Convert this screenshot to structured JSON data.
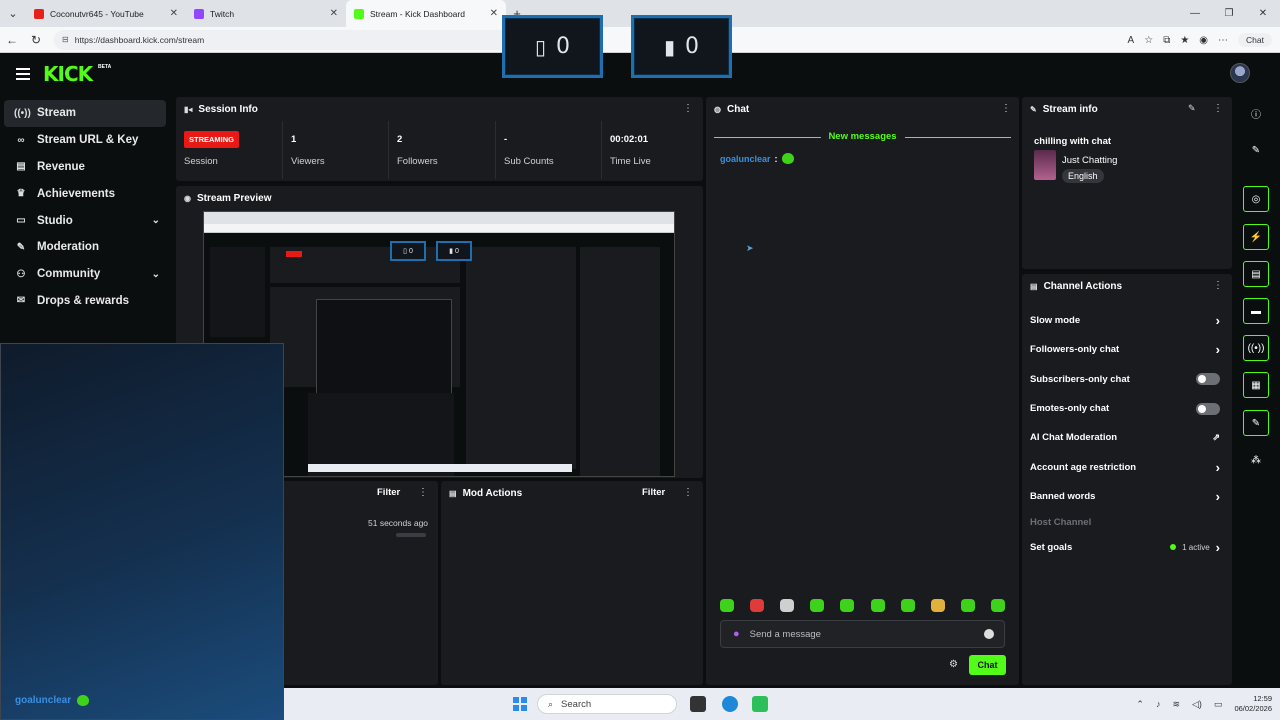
{
  "browser": {
    "tabs": [
      {
        "title": "Coconutvr645 - YouTube",
        "close": "✕"
      },
      {
        "title": "Twitch",
        "close": "✕"
      },
      {
        "title": "Stream - Kick Dashboard",
        "close": "✕"
      }
    ],
    "new_tab": "+",
    "url": "https://dashboard.kick.com/stream",
    "copilot_label": "Chat"
  },
  "header": {
    "logo": "KICK",
    "logo_badge": "BETA"
  },
  "counters": [
    {
      "glyph": "▯",
      "value": "0"
    },
    {
      "glyph": "▮",
      "value": "0"
    }
  ],
  "sidebar": {
    "items": [
      {
        "label": "Stream",
        "icon": "stream-icon"
      },
      {
        "label": "Stream URL & Key",
        "icon": "link-icon"
      },
      {
        "label": "Revenue",
        "icon": "revenue-icon"
      },
      {
        "label": "Achievements",
        "icon": "trophy-icon"
      },
      {
        "label": "Studio",
        "icon": "studio-icon"
      },
      {
        "label": "Moderation",
        "icon": "wrench-icon"
      },
      {
        "label": "Community",
        "icon": "community-icon"
      },
      {
        "label": "Drops & rewards",
        "icon": "gift-icon"
      }
    ]
  },
  "session_info": {
    "title": "Session Info",
    "status_badge": "STREAMING",
    "status_label": "Session",
    "stats": [
      {
        "value": "1",
        "label": "Viewers"
      },
      {
        "value": "2",
        "label": "Followers"
      },
      {
        "value": "-",
        "label": "Sub Counts"
      },
      {
        "value": "00:02:01",
        "label": "Time Live"
      }
    ]
  },
  "stream_preview": {
    "title": "Stream Preview"
  },
  "activity": {
    "filter_label": "Filter",
    "time_ago": "51 seconds ago"
  },
  "mod_actions": {
    "title": "Mod Actions",
    "filter_label": "Filter"
  },
  "overlay": {
    "username": "goalunclear"
  },
  "chat": {
    "title": "Chat",
    "new_messages": "New messages",
    "message_user": "goalunclear",
    "message_sep": ":",
    "placeholder": "Send a message",
    "send_label": "Chat",
    "emote_colors": [
      "#3fd21a",
      "#e03b3b",
      "#cfcfcf",
      "#3fd21a",
      "#3fd21a",
      "#3fd21a",
      "#3fd21a",
      "#e0b23b",
      "#3fd21a",
      "#3fd21a"
    ]
  },
  "stream_info": {
    "title": "Stream info",
    "stream_title": "chilling with chat",
    "category": "Just Chatting",
    "language": "English"
  },
  "channel_actions": {
    "title": "Channel Actions",
    "rows": [
      {
        "label": "Slow mode",
        "control": "chevron"
      },
      {
        "label": "Followers-only chat",
        "control": "chevron"
      },
      {
        "label": "Subscribers-only chat",
        "control": "toggle"
      },
      {
        "label": "Emotes-only chat",
        "control": "toggle"
      },
      {
        "label": "AI Chat Moderation",
        "control": "external"
      },
      {
        "label": "Account age restriction",
        "control": "chevron"
      },
      {
        "label": "Banned words",
        "control": "chevron"
      },
      {
        "label": "Host Channel",
        "control": "none"
      },
      {
        "label": "Set goals",
        "control": "active",
        "status": "1 active"
      }
    ]
  },
  "taskbar": {
    "search_placeholder": "Search",
    "time": "12:59",
    "date": "06/02/2026"
  },
  "colors": {
    "kick_green": "#53fc18",
    "streaming_red": "#e91916",
    "panel": "#191b1f",
    "background": "#0b0e0f",
    "counter_border": "#1f6fb0"
  }
}
